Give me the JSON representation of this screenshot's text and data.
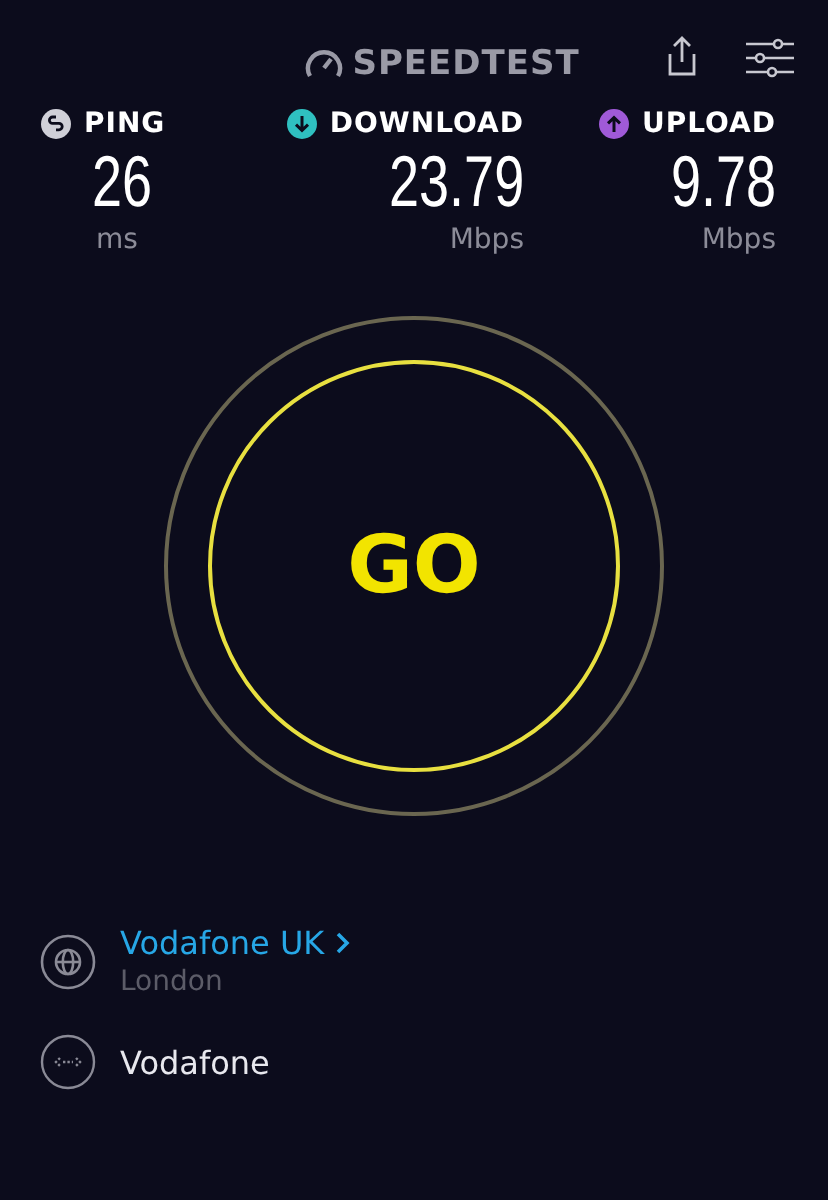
{
  "header": {
    "logo": "SPEEDTEST"
  },
  "metrics": [
    {
      "kind": "ping",
      "label": "PING",
      "value": "26",
      "unit": "ms"
    },
    {
      "kind": "download",
      "label": "DOWNLOAD",
      "value": "23.79",
      "unit": "Mbps"
    },
    {
      "kind": "upload",
      "label": "UPLOAD",
      "value": "9.78",
      "unit": "Mbps"
    }
  ],
  "go_button": {
    "label": "GO"
  },
  "server": {
    "name": "Vodafone UK",
    "location": "London"
  },
  "provider": {
    "name": "Vodafone"
  }
}
